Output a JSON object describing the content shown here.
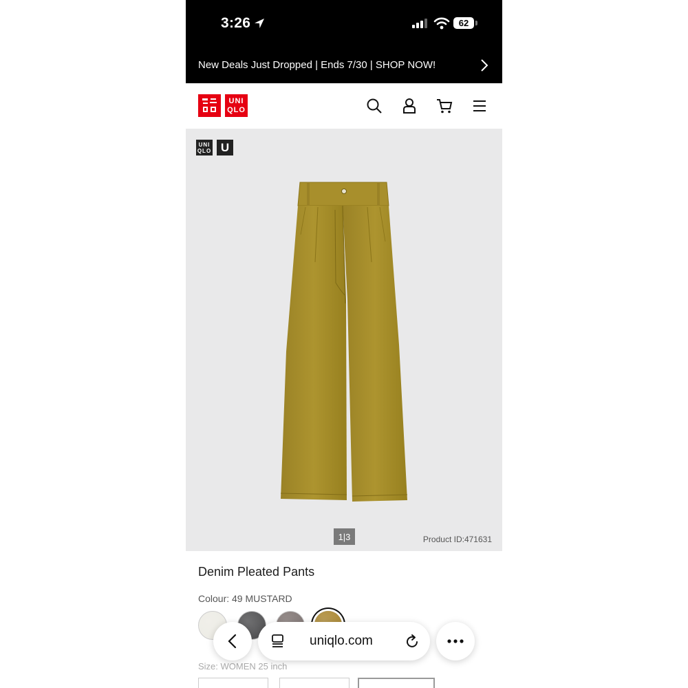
{
  "status_bar": {
    "time": "3:26",
    "battery": "62"
  },
  "promo": {
    "text": "New Deals Just Dropped | Ends 7/30 | SHOP NOW!"
  },
  "header": {
    "logo_top": "ユニ\nクロ",
    "logo_bottom": "UNI\nQLO",
    "icons": [
      "search-icon",
      "account-icon",
      "cart-icon",
      "menu-icon"
    ]
  },
  "product": {
    "badge_uniqlo": "UNI QLO",
    "badge_u": "U",
    "image_pager": "1|3",
    "product_id": "Product ID:471631",
    "name": "Denim Pleated Pants",
    "colour_label": "Colour: 49 MUSTARD",
    "swatches": [
      {
        "name": "off-white",
        "color": "#ecebe4"
      },
      {
        "name": "dark-gray",
        "color": "#4c4c4e"
      },
      {
        "name": "brown-gray",
        "color": "#7d7270"
      },
      {
        "name": "mustard",
        "color": "#a8842d",
        "selected": true
      }
    ],
    "size_label": "Size: WOMEN 25 inch",
    "pants_color": "#a18b2a"
  },
  "browser": {
    "url": "uniqlo.com"
  }
}
